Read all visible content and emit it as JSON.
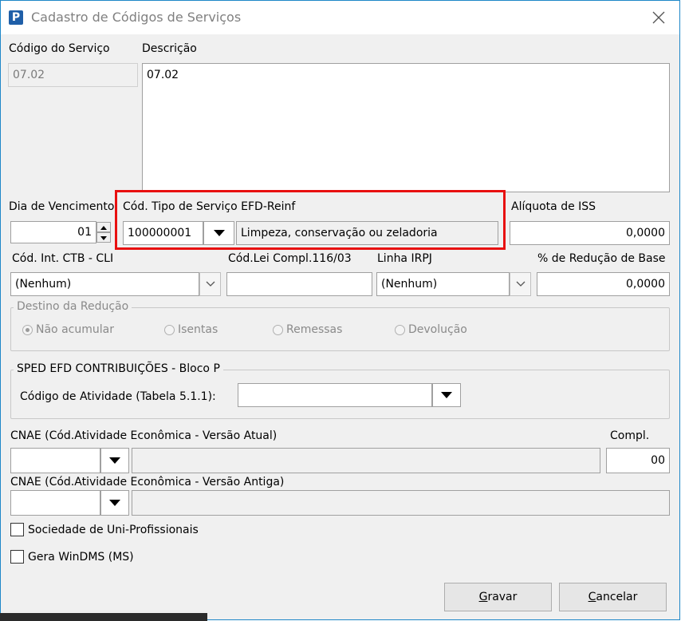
{
  "window": {
    "title": "Cadastro de Códigos de Serviços",
    "app_icon": "P"
  },
  "codigo": {
    "label": "Código do Serviço",
    "value": "07.02"
  },
  "descricao": {
    "label": "Descrição",
    "value": "07.02"
  },
  "vencimento": {
    "label": "Dia de Vencimento",
    "value": "01"
  },
  "reinf": {
    "label": "Cód. Tipo de Serviço EFD-Reinf",
    "code": "100000001",
    "description": "Limpeza, conservação ou zeladoria"
  },
  "iss": {
    "label": "Alíquota de ISS",
    "value": "0,0000"
  },
  "ctb": {
    "label": "Cód. Int. CTB - CLI",
    "value": "(Nenhum)"
  },
  "lei": {
    "label": "Cód.Lei Compl.116/03",
    "value": ""
  },
  "irpj": {
    "label": "Linha IRPJ",
    "value": "(Nenhum)"
  },
  "reducao": {
    "label": "% de Redução de Base",
    "value": "0,0000"
  },
  "destino": {
    "title": "Destino da Redução",
    "options": [
      "Não acumular",
      "Isentas",
      "Remessas",
      "Devolução"
    ],
    "selected": "Não acumular"
  },
  "sped": {
    "title": "SPED EFD CONTRIBUIÇÕES - Bloco P",
    "atividade_label": "Código de Atividade (Tabela 5.1.1):",
    "atividade_value": ""
  },
  "cnae_atual": {
    "label": "CNAE (Cód.Atividade Econômica - Versão Atual)",
    "value": "",
    "desc": ""
  },
  "compl": {
    "label": "Compl.",
    "value": "00"
  },
  "cnae_antiga": {
    "label": "CNAE (Cód.Atividade Econômica - Versão Antiga)",
    "value": "",
    "desc": ""
  },
  "checks": {
    "uni": "Sociedade de Uni-Profissionais",
    "windms": "Gera WinDMS (MS)"
  },
  "buttons": {
    "gravar_first": "G",
    "gravar_rest": "ravar",
    "cancelar_first": "C",
    "cancelar_rest": "ancelar"
  },
  "colors": {
    "highlight": "#e81010",
    "window_border": "#1e87c8"
  }
}
